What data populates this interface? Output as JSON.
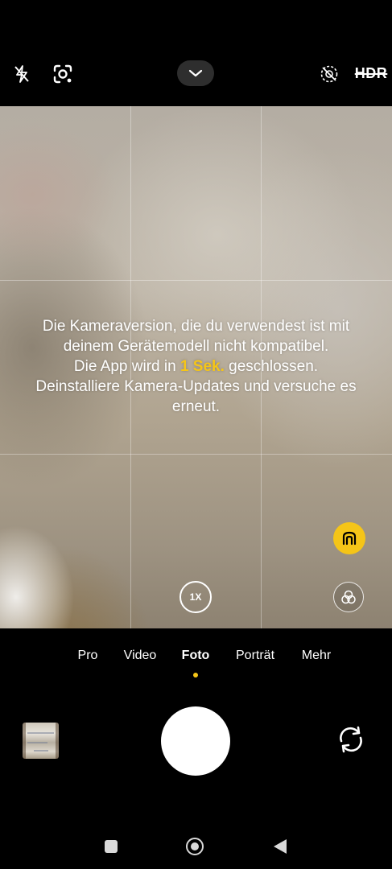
{
  "top_bar": {
    "flash_icon": "flash-off-icon",
    "lens_icon": "google-lens-icon",
    "expand_icon": "chevron-down-icon",
    "motion_photo_icon": "motion-photo-off-icon",
    "hdr_label": "HDR"
  },
  "viewfinder": {
    "message_line1": "Die Kameraversion, die du verwendest ist mit",
    "message_line2": "deinem Gerätemodell nicht kompatibel.",
    "message_line3_before": "Die App wird in ",
    "message_line3_highlight": "1 Sek.",
    "message_line3_after": " geschlossen.",
    "message_line4": "Deinstalliere Kamera-Updates und versuche es",
    "message_line5": "erneut.",
    "zoom_label": "1X",
    "ai_icon": "ai-scene-icon",
    "filter_icon": "filter-icon"
  },
  "modes": {
    "items": [
      "Pro",
      "Video",
      "Foto",
      "Porträt",
      "Mehr"
    ],
    "active": "Foto"
  },
  "controls": {
    "gallery_icon": "gallery-thumbnail",
    "shutter_icon": "shutter-button",
    "switch_icon": "switch-camera-icon"
  },
  "nav_bar": {
    "recents_icon": "recents-square-icon",
    "home_icon": "home-circle-icon",
    "back_icon": "back-triangle-icon"
  },
  "colors": {
    "accent": "#f5c518",
    "background": "#000000"
  }
}
